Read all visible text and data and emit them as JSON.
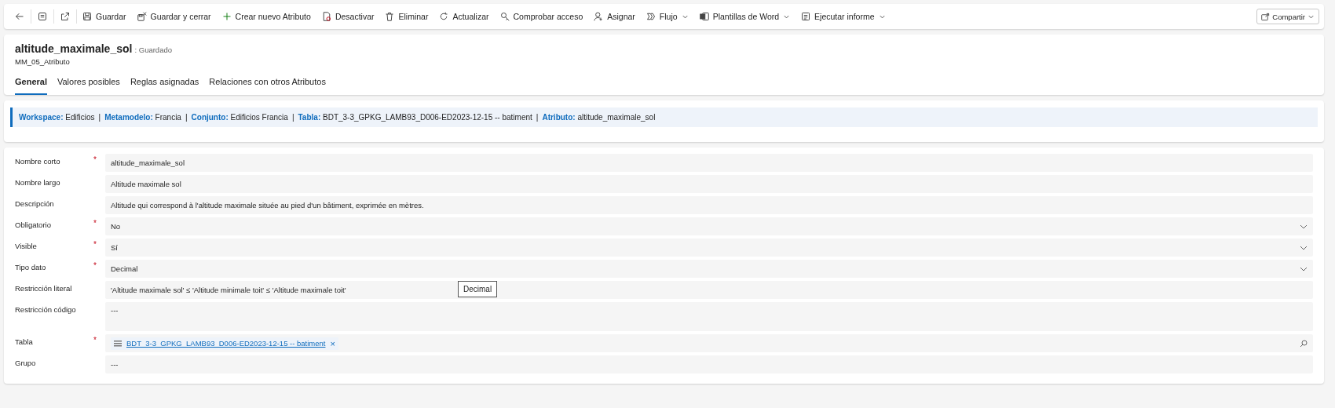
{
  "toolbar": {
    "items": [
      {
        "label": "Guardar",
        "menu": false
      },
      {
        "label": "Guardar y cerrar",
        "menu": false
      },
      {
        "label": "Crear nuevo Atributo",
        "menu": false
      },
      {
        "label": "Desactivar",
        "menu": false
      },
      {
        "label": "Eliminar",
        "menu": false
      },
      {
        "label": "Actualizar",
        "menu": false
      },
      {
        "label": "Comprobar acceso",
        "menu": false
      },
      {
        "label": "Asignar",
        "menu": false
      },
      {
        "label": "Flujo",
        "menu": true
      },
      {
        "label": "Plantillas de Word",
        "menu": true
      },
      {
        "label": "Ejecutar informe",
        "menu": true
      }
    ],
    "share": {
      "label": "Compartir",
      "menu": true
    }
  },
  "header": {
    "title": "altitude_maximale_sol",
    "status": ": Guardado",
    "entity": "MM_05_Atributo"
  },
  "tabs": [
    {
      "label": "General",
      "selected": true
    },
    {
      "label": "Valores posibles",
      "selected": false
    },
    {
      "label": "Reglas asignadas",
      "selected": false
    },
    {
      "label": "Relaciones con otros Atributos",
      "selected": false
    }
  ],
  "breadcrumb": {
    "separator": "|",
    "segments": [
      {
        "label": "Workspace:",
        "value": "Edificios"
      },
      {
        "label": "Metamodelo:",
        "value": "Francia"
      },
      {
        "label": "Conjunto:",
        "value": "Edificios Francia"
      },
      {
        "label": "Tabla:",
        "value": "BDT_3-3_GPKG_LAMB93_D006-ED2023-12-15 -- batiment"
      },
      {
        "label": "Atributo:",
        "value": "altitude_maximale_sol"
      }
    ]
  },
  "required_mark": "*",
  "fields": [
    {
      "kind": "text",
      "label": "Nombre corto",
      "required": true,
      "value": "altitude_maximale_sol"
    },
    {
      "kind": "text",
      "label": "Nombre largo",
      "required": false,
      "value": "Altitude maximale sol"
    },
    {
      "kind": "text",
      "label": "Descripción",
      "required": false,
      "value": "Altitude qui correspond à l'altitude maximale située au pied d'un bâtiment, exprimée en mètres."
    },
    {
      "kind": "select",
      "label": "Obligatorio",
      "required": true,
      "value": "No"
    },
    {
      "kind": "select",
      "label": "Visible",
      "required": true,
      "value": "Sí"
    },
    {
      "kind": "select",
      "label": "Tipo dato",
      "required": true,
      "value": "Decimal"
    },
    {
      "kind": "text",
      "label": "Restricción literal",
      "required": false,
      "value": "'Altitude maximale sol' ≤ 'Altitude minimale toit' ≤ 'Altitude maximale toit'"
    },
    {
      "kind": "textarea",
      "label": "Restricción código",
      "required": false,
      "value": "---"
    },
    {
      "kind": "lookup",
      "label": "Tabla",
      "required": true,
      "value": "BDT_3-3_GPKG_LAMB93_D006-ED2023-12-15 -- batiment",
      "remove": "×"
    },
    {
      "kind": "text",
      "label": "Grupo",
      "required": false,
      "value": "---"
    }
  ],
  "tooltip": {
    "text": "Decimal"
  }
}
